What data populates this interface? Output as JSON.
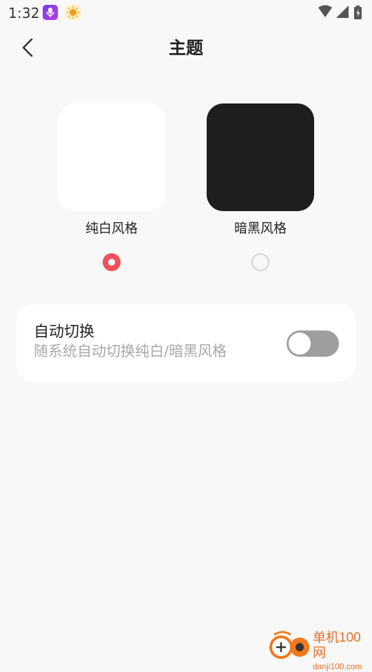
{
  "status_bar": {
    "time": "1:32",
    "app_icons": [
      "podcast-mic-icon",
      "sun-icon"
    ],
    "indicators": [
      "wifi-icon",
      "cell-signal-icon",
      "battery-charging-icon"
    ]
  },
  "header": {
    "title": "主题",
    "back_icon": "chevron-left-icon"
  },
  "themes": [
    {
      "label": "纯白风格",
      "selected": true,
      "preview_color": "#ffffff"
    },
    {
      "label": "暗黑风格",
      "selected": false,
      "preview_color": "#1e1e20"
    }
  ],
  "auto_switch": {
    "title": "自动切换",
    "subtitle": "随系统自动切换纯白/暗黑风格",
    "enabled": false
  },
  "watermark": {
    "text": "单机100网",
    "url": "danji100.com"
  },
  "colors": {
    "accent": "#f0505a",
    "background": "#f8f8f8",
    "card": "#ffffff",
    "toggle_off": "#9e9e9e"
  }
}
